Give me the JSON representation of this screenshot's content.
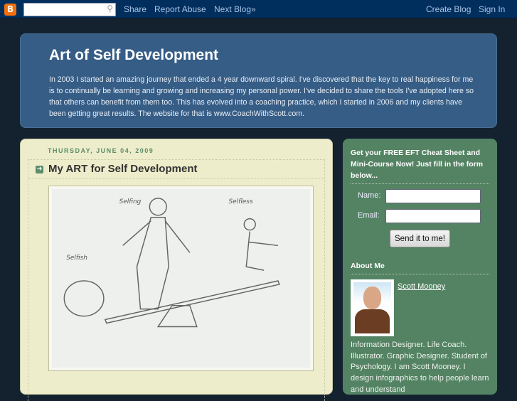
{
  "navbar": {
    "logo": "B",
    "search_placeholder": "",
    "share": "Share",
    "report": "Report Abuse",
    "next": "Next Blog»",
    "create": "Create Blog",
    "signin": "Sign In"
  },
  "header": {
    "title": "Art of Self Development",
    "description": "In 2003 I started an amazing journey that ended a 4 year downward spiral. I've discovered that the key to real happiness for me is to continually be learning and growing and increasing my personal power. I've decided to share the tools I've adopted here so that others can benefit from them too. This has evolved into a coaching practice, which I started in 2006 and my clients have been getting great results. The website for that is www.CoachWithScott.com."
  },
  "post": {
    "date": "THURSDAY, JUNE 04, 2009",
    "title": "My ART for Self Development",
    "sketch_labels": [
      "Selfish",
      "Selfing",
      "Selfless"
    ]
  },
  "sidebar": {
    "eft_title": "Get your FREE EFT Cheat Sheet and Mini-Course Now! Just fill in the form below...",
    "name_label": "Name:",
    "email_label": "Email:",
    "submit": "Send it to me!",
    "about_title": "About Me",
    "author": "Scott Mooney",
    "bio": "Information Designer. Life Coach. Illustrator. Graphic Designer. Student of Psychology. I am Scott Mooney. I design infographics to help people learn and understand"
  }
}
